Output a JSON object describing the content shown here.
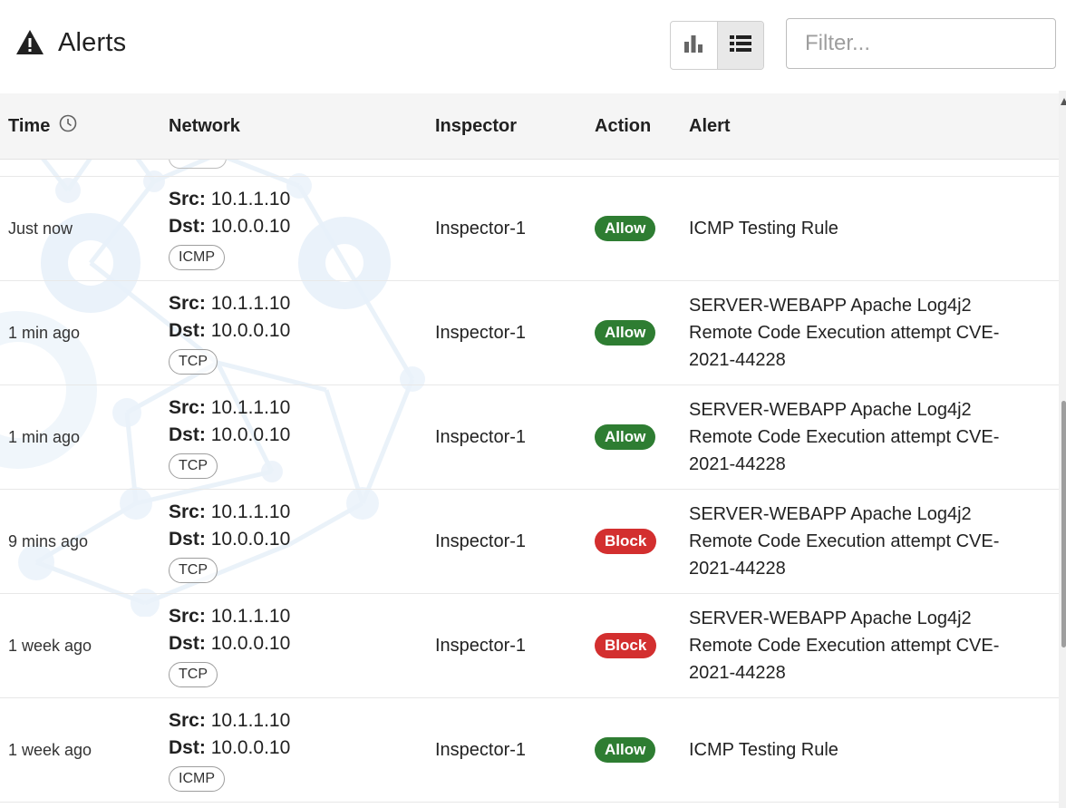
{
  "header": {
    "title": "Alerts",
    "title_icon": "warning-triangle-icon",
    "view_toggle": [
      {
        "icon": "bar-chart-icon",
        "active": false
      },
      {
        "icon": "list-icon",
        "active": true
      }
    ],
    "filter": {
      "placeholder": "Filter...",
      "value": ""
    }
  },
  "table": {
    "columns": {
      "time": "Time",
      "network": "Network",
      "inspector": "Inspector",
      "action": "Action",
      "alert": "Alert"
    },
    "time_sort_icon": "clock-icon",
    "src_label": "Src:",
    "dst_label": "Dst:",
    "rows": [
      {
        "time": "Just now",
        "src": "10.1.1.10",
        "dst": "10.0.0.10",
        "protocol": "ICMP",
        "inspector": "Inspector-1",
        "action": "Allow",
        "alert": "ICMP Testing Rule"
      },
      {
        "time": "1 min ago",
        "src": "10.1.1.10",
        "dst": "10.0.0.10",
        "protocol": "TCP",
        "inspector": "Inspector-1",
        "action": "Allow",
        "alert": "SERVER-WEBAPP Apache Log4j2 Remote Code Execution attempt CVE-2021-44228"
      },
      {
        "time": "1 min ago",
        "src": "10.1.1.10",
        "dst": "10.0.0.10",
        "protocol": "TCP",
        "inspector": "Inspector-1",
        "action": "Allow",
        "alert": "SERVER-WEBAPP Apache Log4j2 Remote Code Execution attempt CVE-2021-44228"
      },
      {
        "time": "9 mins ago",
        "src": "10.1.1.10",
        "dst": "10.0.0.10",
        "protocol": "TCP",
        "inspector": "Inspector-1",
        "action": "Block",
        "alert": "SERVER-WEBAPP Apache Log4j2 Remote Code Execution attempt CVE-2021-44228"
      },
      {
        "time": "1 week ago",
        "src": "10.1.1.10",
        "dst": "10.0.0.10",
        "protocol": "TCP",
        "inspector": "Inspector-1",
        "action": "Block",
        "alert": "SERVER-WEBAPP Apache Log4j2 Remote Code Execution attempt CVE-2021-44228"
      },
      {
        "time": "1 week ago",
        "src": "10.1.1.10",
        "dst": "10.0.0.10",
        "protocol": "ICMP",
        "inspector": "Inspector-1",
        "action": "Allow",
        "alert": "ICMP Testing Rule"
      }
    ]
  },
  "colors": {
    "allow": "#2e7d32",
    "block": "#d32f2f",
    "header_bg": "#f5f5f5"
  }
}
